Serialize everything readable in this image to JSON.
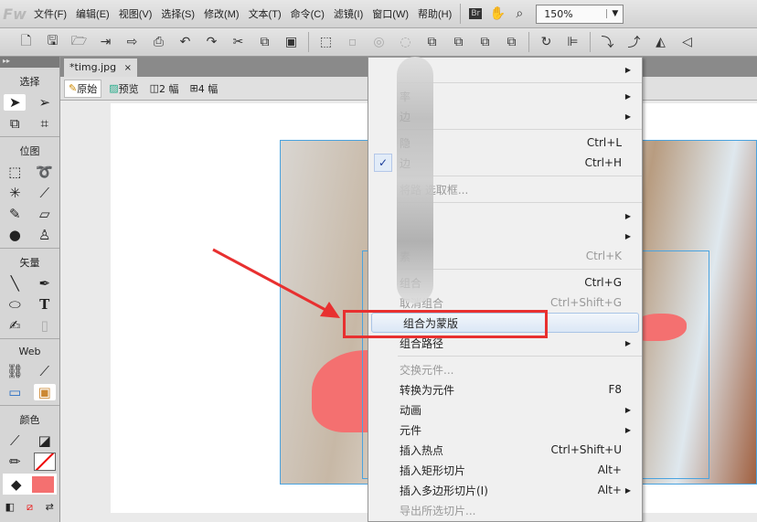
{
  "app": {
    "logo": "Fw"
  },
  "menubar": {
    "items": [
      "文件(F)",
      "编辑(E)",
      "视图(V)",
      "选择(S)",
      "修改(M)",
      "文本(T)",
      "命令(C)",
      "滤镜(I)",
      "窗口(W)",
      "帮助(H)"
    ],
    "bridge": "Br",
    "zoom": "150%"
  },
  "tools": {
    "groups": [
      "选择",
      "位图",
      "矢量",
      "Web",
      "颜色"
    ]
  },
  "document": {
    "tab": "*timg.jpg",
    "close": "×",
    "views": [
      "原始",
      "预览",
      "2 幅",
      "4 幅"
    ]
  },
  "context_menu": {
    "items": [
      {
        "label": "",
        "arrow": true
      },
      {
        "sep": true
      },
      {
        "label": "率",
        "arrow": true
      },
      {
        "label": "边",
        "arrow": true
      },
      {
        "sep": true
      },
      {
        "label": "隐",
        "shortcut": "Ctrl+L"
      },
      {
        "label": "边",
        "shortcut": "Ctrl+H",
        "checked": true
      },
      {
        "sep": true
      },
      {
        "label": "将路                选取框...",
        "disabled": true
      },
      {
        "sep": true
      },
      {
        "label": "",
        "arrow": true
      },
      {
        "label": "",
        "arrow": true
      },
      {
        "label": "素",
        "shortcut": "Ctrl+K",
        "disabled": true
      },
      {
        "sep": true
      },
      {
        "label": "组合",
        "shortcut": "Ctrl+G"
      },
      {
        "label": "取消组合",
        "shortcut": "Ctrl+Shift+G",
        "disabled": true
      },
      {
        "label": "组合为蒙版",
        "highlighted": true
      },
      {
        "label": "组合路径",
        "arrow": true
      },
      {
        "sep": true
      },
      {
        "label": "交换元件...",
        "disabled": true
      },
      {
        "label": "转换为元件",
        "shortcut": "F8"
      },
      {
        "label": "动画",
        "arrow": true
      },
      {
        "label": "元件",
        "arrow": true
      },
      {
        "label": "插入热点",
        "shortcut": "Ctrl+Shift+U"
      },
      {
        "label": "插入矩形切片",
        "shortcut": "Alt+"
      },
      {
        "label": "插入多边形切片(I)",
        "shortcut": "Alt+",
        "arrow": true
      },
      {
        "label": "导出所选切片...",
        "disabled": true
      }
    ]
  },
  "colors": {
    "annotation": "#e83030",
    "fill": "#f47070"
  }
}
